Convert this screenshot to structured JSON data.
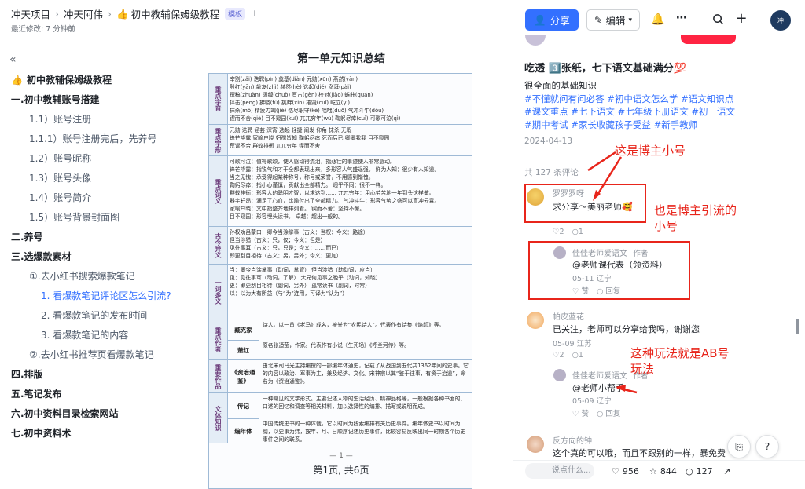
{
  "breadcrumb": {
    "items": [
      "冲天项目",
      "冲天阿伟"
    ],
    "current": "初中教辅保姆级教程",
    "current_emoji": "👍",
    "tag": "模板",
    "last_modified": "最近修改: 7 分钟前"
  },
  "toc": [
    {
      "text": "初中教辅保姆级教程",
      "level": 0,
      "emoji": "👍"
    },
    {
      "text": "一.初中教辅账号搭建",
      "level": 0
    },
    {
      "text": "1.1）账号注册",
      "level": 1
    },
    {
      "text": "1.1.1）账号注册完后，先养号",
      "level": 1
    },
    {
      "text": "1.2）账号昵称",
      "level": 1
    },
    {
      "text": "1.3）账号头像",
      "level": 1
    },
    {
      "text": "1.4）账号简介",
      "level": 1
    },
    {
      "text": "1.5）账号背景封面图",
      "level": 1
    },
    {
      "text": "二.养号",
      "level": 0
    },
    {
      "text": "三.选爆款素材",
      "level": 0
    },
    {
      "text": "①.去小红书搜索爆款笔记",
      "level": 1
    },
    {
      "text": "1. 看爆款笔记评论区怎么引流?",
      "level": 2,
      "active": true
    },
    {
      "text": "2. 看爆款笔记的发布时间",
      "level": 2
    },
    {
      "text": "3. 看爆款笔记的内容",
      "level": 2
    },
    {
      "text": "②.去小红书推荐页看爆款笔记",
      "level": 1
    },
    {
      "text": "四.排版",
      "level": 0
    },
    {
      "text": "五.笔记发布",
      "level": 0
    },
    {
      "text": "六.初中资料目录检索网站",
      "level": 0
    },
    {
      "text": "七.初中资料术",
      "level": 0
    }
  ],
  "document": {
    "title": "第一单元知识总结",
    "page_number": "— 1 —",
    "page_indicator": "第1页, 共6页",
    "sections": [
      {
        "head": "重点字音",
        "lines": [
          "宰割(zǎi)   迭聘(pìn)   奠基(diàn)   元勋(xūn)   燕然(yān)",
          "殷红(yān)   挚友(zhì)   赫然(hè)   选起(dié)   澎湃(pài)",
          "撰稿(zhuàn)   阔绰(chuò)   亘古(gèn)   校对(jiào)   蜷曲(quán)",
          "抨击(pēng)   拂晓(fú)   挑衅(xìn)   摧毁(cuī)   屹立(yì)",
          "抹杀(mǒ)   精疲力竭(jié)   恪尽职守(kè)   咄咄(duō)   气冲斗牛(dǒu)",
          "锲而不舍(qiè)   目不窥园(kuī)   兀兀穷年(wù)   鞠躬尽瘁(cuì)   可歌可泣(qì)"
        ]
      },
      {
        "head": "重点字形",
        "lines": [
          "元勋   迭聘   涵芸   深宵   选起   轻捷   阐发   仰角   抹杀   无暇",
          "锋芒毕露   家喻户晓   妇孺皆知   鞠躬尽瘁   死而后已   卿卿我我   目不窥园",
          "荒谬不合   群蚁排衙   兀兀穷年   锲而不舍"
        ]
      },
      {
        "head": "重点词义",
        "lines": [
          "可歌可泣：值得歌颂，使人感动得流泪，指悲壮的事迹使人非常感动。",
          "锋芒毕露：指锐气和才干全都表现出来，多形容人气盛逞强。   鲜为人知：很少有人知道。",
          "当之无愧：承受得起某种称号，称号或荣誉，不用感到惭愧。",
          "鞠躬尽瘁：指小心谨慎，贡献出全部精力。   迥乎不同：很不一样。",
          "群蚁排衙：形容人的聪明才智，以求达到……   兀兀穷年：用心劳苦地一年到头这样做。",
          "器宇轩昂：满足了心血，比喻付出了全部精力。   气冲斗牛：形容气势之盛可以直冲云霄。",
          "家喻户晓：文中指整齐地排列着。   锲而不舍：坚持不懈。",
          "目不窥园：形容埋头读书。   卓越：超出一般的。"
        ]
      },
      {
        "head": "古今异义",
        "lines": [
          "孙权劝吕蒙曰：卿今当涂掌事（古义：当权；今义：路途）",
          "但当涉猎（古义：只，仅；今义：但是）",
          "见往事耳（古义：只，只是；今义：……而已）",
          "即更刮目相待（古义：另，另外；今义：更加）"
        ]
      },
      {
        "head": "一词多义",
        "lines": [
          "当：卿今当涂掌事（动词，掌管）   但当涉猎（助动词，应当）",
          "见：见往事耳（动词，了解）   大兄何见事之晚乎（动词，知晓）",
          "更：即更刮目相待（副词，另外）   孤常读书（副词，时常）",
          "以：以为大有所益（与“为”连用，可译为“认为”）"
        ]
      },
      {
        "head": "重点作者",
        "sub": [
          "臧克家",
          "萧红"
        ],
        "lines": [
          "诗人。以一首《老马》成名，被誉为“农民诗人”。代表作有诗集《烙印》等。",
          "原名张迺莹，作家。代表作有小说《生死场》《呼兰河传》等。"
        ]
      },
      {
        "head": "重要作品",
        "sub": [
          "《资治通鉴》"
        ],
        "lines": [
          "由北宋司马光主持编撰的一部编年体通史，记载了从战国到五代共1362年间的史事。它的内容以政治、军事为主，兼及经济、文化。宋神宗以其“鉴于往事，有资于治道”，命名为《资治通鉴》。"
        ]
      },
      {
        "head": "文体知识",
        "sub": [
          "传记",
          "编年体"
        ],
        "lines": [
          "一种常见的文学形式。主要记述人物的生活经历、精神品格等，一般根据各种书面的、口述的回忆和调查等相关材料，加以选择性的编排、描写或说明而成。",
          "中国传统史书的一种体裁，它以时间为线索编排有关历史事件。编年体史书以时间为纲，以史事为纬，按年、月、日顺序记述历史事件，比较容易反映出同一时期各个历史事件之间的联系。"
        ]
      }
    ]
  },
  "toolbar": {
    "share": "分享",
    "edit": "编辑"
  },
  "post": {
    "title": "吃透 3️⃣张纸，七下语文基础满分💯",
    "desc": "很全面的基础知识",
    "tags": [
      "#不懂就问有问必答",
      "#初中语文怎么学",
      "#语文知识点",
      "#课文重点",
      "#七下语文",
      "#七年级下册语文",
      "#初一语文",
      "#期中考试",
      "#家长收藏孩子受益",
      "#新手教师"
    ],
    "date": "2024-04-13",
    "comment_count": "共 127 条评论"
  },
  "comments": [
    {
      "name": "罗罗罗呀",
      "text": "求分享～美丽老师🥰",
      "meta_likes": "2",
      "meta_replies": "1"
    },
    {
      "name": "佳佳老师爱语文",
      "badge": "作者",
      "text": "@老师课代表（领资料）",
      "meta_date": "05-11 辽宁",
      "like": "赞",
      "reply": "回复"
    },
    {
      "name": "帕皮蓝花",
      "text": "已关注，老师可以分享给我吗，谢谢您",
      "meta_date": "05-09 江苏",
      "meta_likes": "2",
      "meta_replies": "1"
    },
    {
      "name": "佳佳老师爱语文",
      "badge": "作者",
      "text": "@老师小帮手",
      "meta_date": "05-09 辽宁",
      "like": "赞",
      "reply": "回复"
    },
    {
      "name": "反方向的钟",
      "text": "这个真的可以哦，而且不跟别的一样，暴免费的，娟"
    }
  ],
  "annotations": {
    "a1": "这是博主小号",
    "a2": "也是博主引流的小号",
    "a3": "这种玩法就是AB号玩法"
  },
  "bottom_bar": {
    "placeholder": "说点什么...",
    "likes": "956",
    "favorites": "844",
    "comments": "127"
  },
  "colors": {
    "accent": "#3370ff",
    "annotation": "#e8251b"
  }
}
